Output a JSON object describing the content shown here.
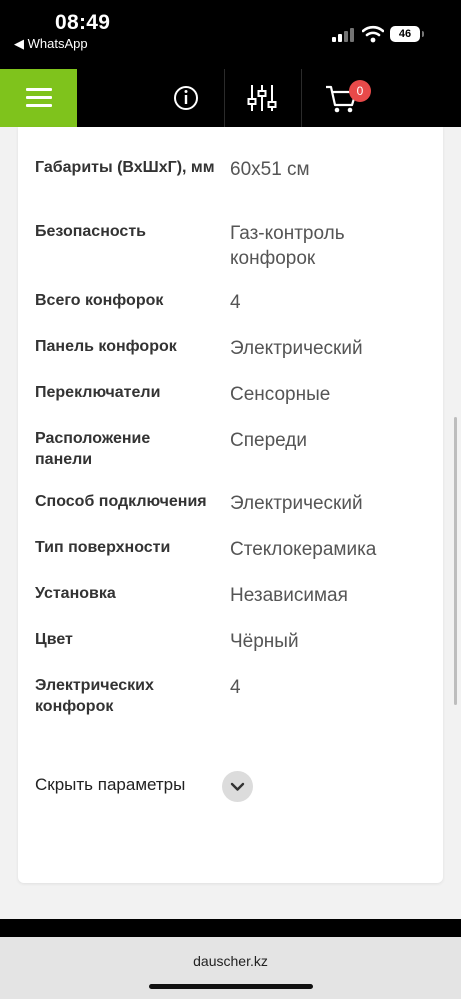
{
  "status_bar": {
    "time": "08:49",
    "back_app": "◀ WhatsApp",
    "battery": "46"
  },
  "header": {
    "menu_icon": "hamburger-icon",
    "icons": [
      "info-icon",
      "filter-sliders-icon",
      "cart-icon"
    ],
    "cart_count": "0",
    "accent_color": "#7fc31c"
  },
  "specs": [
    {
      "label": "Габариты (ВхШхГ), мм",
      "value": "60x51 см"
    },
    {
      "label": "Безопасность",
      "value": "Газ-контроль конфорок"
    },
    {
      "label": "Всего конфорок",
      "value": "4"
    },
    {
      "label": "Панель конфорок",
      "value": "Электрический"
    },
    {
      "label": "Переключатели",
      "value": "Сенсорные"
    },
    {
      "label": "Расположение панели",
      "value": "Спереди"
    },
    {
      "label": "Способ подключения",
      "value": "Электрический"
    },
    {
      "label": "Тип поверхности",
      "value": "Стеклокерамика"
    },
    {
      "label": "Установка",
      "value": "Независимая"
    },
    {
      "label": "Цвет",
      "value": "Чёрный"
    },
    {
      "label": "Электрических конфорок",
      "value": "4"
    }
  ],
  "toggle": {
    "label": "Скрыть параметры",
    "icon": "chevron-down-icon"
  },
  "browser": {
    "url": "dauscher.kz"
  }
}
